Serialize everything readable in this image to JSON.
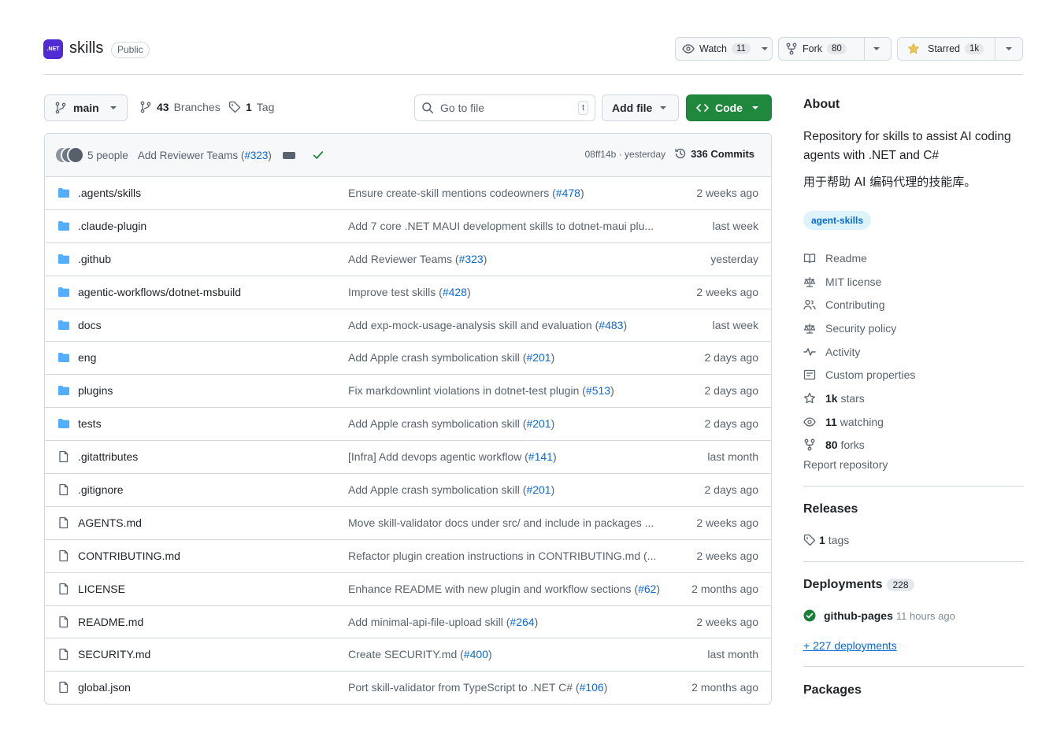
{
  "header": {
    "logo_text": ".NET",
    "repo_name": "skills",
    "visibility": "Public",
    "watch": {
      "label": "Watch",
      "count": "11"
    },
    "fork": {
      "label": "Fork",
      "count": "80"
    },
    "star": {
      "label": "Starred",
      "count": "1k"
    }
  },
  "toolbar": {
    "branch": "main",
    "branches_count": "43",
    "branches_label": "Branches",
    "tags_count": "1",
    "tags_label": "Tag",
    "search_placeholder": "Go to file",
    "search_shortcut": "t",
    "add_file": "Add file",
    "code": "Code"
  },
  "commit": {
    "people": "5 people",
    "message": "Add Reviewer Teams (",
    "pr": "#323",
    "message_end": ")",
    "meta": "08ff14b · yesterday",
    "commits": "336 Commits"
  },
  "files": [
    {
      "type": "dir",
      "name": ".agents/skills",
      "msg": "Ensure create-skill mentions codeowners (",
      "pr": "#478",
      "msg_end": ")",
      "date": "2 weeks ago"
    },
    {
      "type": "dir",
      "name": ".claude-plugin",
      "msg": "Add 7 core .NET MAUI development skills to dotnet-maui plu...",
      "pr": "",
      "msg_end": "",
      "date": "last week"
    },
    {
      "type": "dir",
      "name": ".github",
      "msg": "Add Reviewer Teams (",
      "pr": "#323",
      "msg_end": ")",
      "date": "yesterday"
    },
    {
      "type": "dir",
      "name": "agentic-workflows/dotnet-msbuild",
      "msg": "Improve test skills (",
      "pr": "#428",
      "msg_end": ")",
      "date": "2 weeks ago"
    },
    {
      "type": "dir",
      "name": "docs",
      "msg": "Add exp-mock-usage-analysis skill and evaluation (",
      "pr": "#483",
      "msg_end": ")",
      "date": "last week"
    },
    {
      "type": "dir",
      "name": "eng",
      "msg": "Add Apple crash symbolication skill (",
      "pr": "#201",
      "msg_end": ")",
      "date": "2 days ago"
    },
    {
      "type": "dir",
      "name": "plugins",
      "msg": "Fix markdownlint violations in dotnet-test plugin (",
      "pr": "#513",
      "msg_end": ")",
      "date": "2 days ago"
    },
    {
      "type": "dir",
      "name": "tests",
      "msg": "Add Apple crash symbolication skill (",
      "pr": "#201",
      "msg_end": ")",
      "date": "2 days ago"
    },
    {
      "type": "file",
      "name": ".gitattributes",
      "msg": "[Infra] Add devops agentic workflow (",
      "pr": "#141",
      "msg_end": ")",
      "date": "last month"
    },
    {
      "type": "file",
      "name": ".gitignore",
      "msg": "Add Apple crash symbolication skill (",
      "pr": "#201",
      "msg_end": ")",
      "date": "2 days ago"
    },
    {
      "type": "file",
      "name": "AGENTS.md",
      "msg": "Move skill-validator docs under src/ and include in packages ...",
      "pr": "",
      "msg_end": "",
      "date": "2 weeks ago"
    },
    {
      "type": "file",
      "name": "CONTRIBUTING.md",
      "msg": "Refactor plugin creation instructions in CONTRIBUTING.md (...",
      "pr": "",
      "msg_end": "",
      "date": "2 weeks ago"
    },
    {
      "type": "file",
      "name": "LICENSE",
      "msg": "Enhance README with new plugin and workflow sections (",
      "pr": "#62",
      "msg_end": ")",
      "date": "2 months ago"
    },
    {
      "type": "file",
      "name": "README.md",
      "msg": "Add minimal-api-file-upload skill (",
      "pr": "#264",
      "msg_end": ")",
      "date": "2 weeks ago"
    },
    {
      "type": "file",
      "name": "SECURITY.md",
      "msg": "Create SECURITY.md (",
      "pr": "#400",
      "msg_end": ")",
      "date": "last month"
    },
    {
      "type": "file",
      "name": "global.json",
      "msg": "Port skill-validator from TypeScript to .NET C# (",
      "pr": "#106",
      "msg_end": ")",
      "date": "2 months ago"
    }
  ],
  "about": {
    "heading": "About",
    "description": "Repository for skills to assist AI coding agents with .NET and C#",
    "description_cn": "用于帮助 AI 编码代理的技能库。",
    "topic": "agent-skills",
    "items": [
      {
        "icon": "book-icon",
        "label": "Readme"
      },
      {
        "icon": "scale-icon",
        "label": "MIT license"
      },
      {
        "icon": "people-icon",
        "label": "Contributing"
      },
      {
        "icon": "scale-icon",
        "label": "Security policy"
      },
      {
        "icon": "pulse-icon",
        "label": "Activity"
      },
      {
        "icon": "note-icon",
        "label": "Custom properties"
      },
      {
        "icon": "star-icon",
        "bold": "1k",
        "label": "stars"
      },
      {
        "icon": "eye-icon",
        "bold": "11",
        "label": "watching"
      },
      {
        "icon": "fork-icon",
        "bold": "80",
        "label": "forks"
      }
    ],
    "report": "Report repository"
  },
  "releases": {
    "heading": "Releases",
    "tags_count": "1",
    "tags_label": "tags"
  },
  "deployments": {
    "heading": "Deployments",
    "count": "228",
    "env": "github-pages",
    "env_time": "11 hours ago",
    "more": "+ 227 deployments"
  },
  "packages": {
    "heading": "Packages"
  }
}
